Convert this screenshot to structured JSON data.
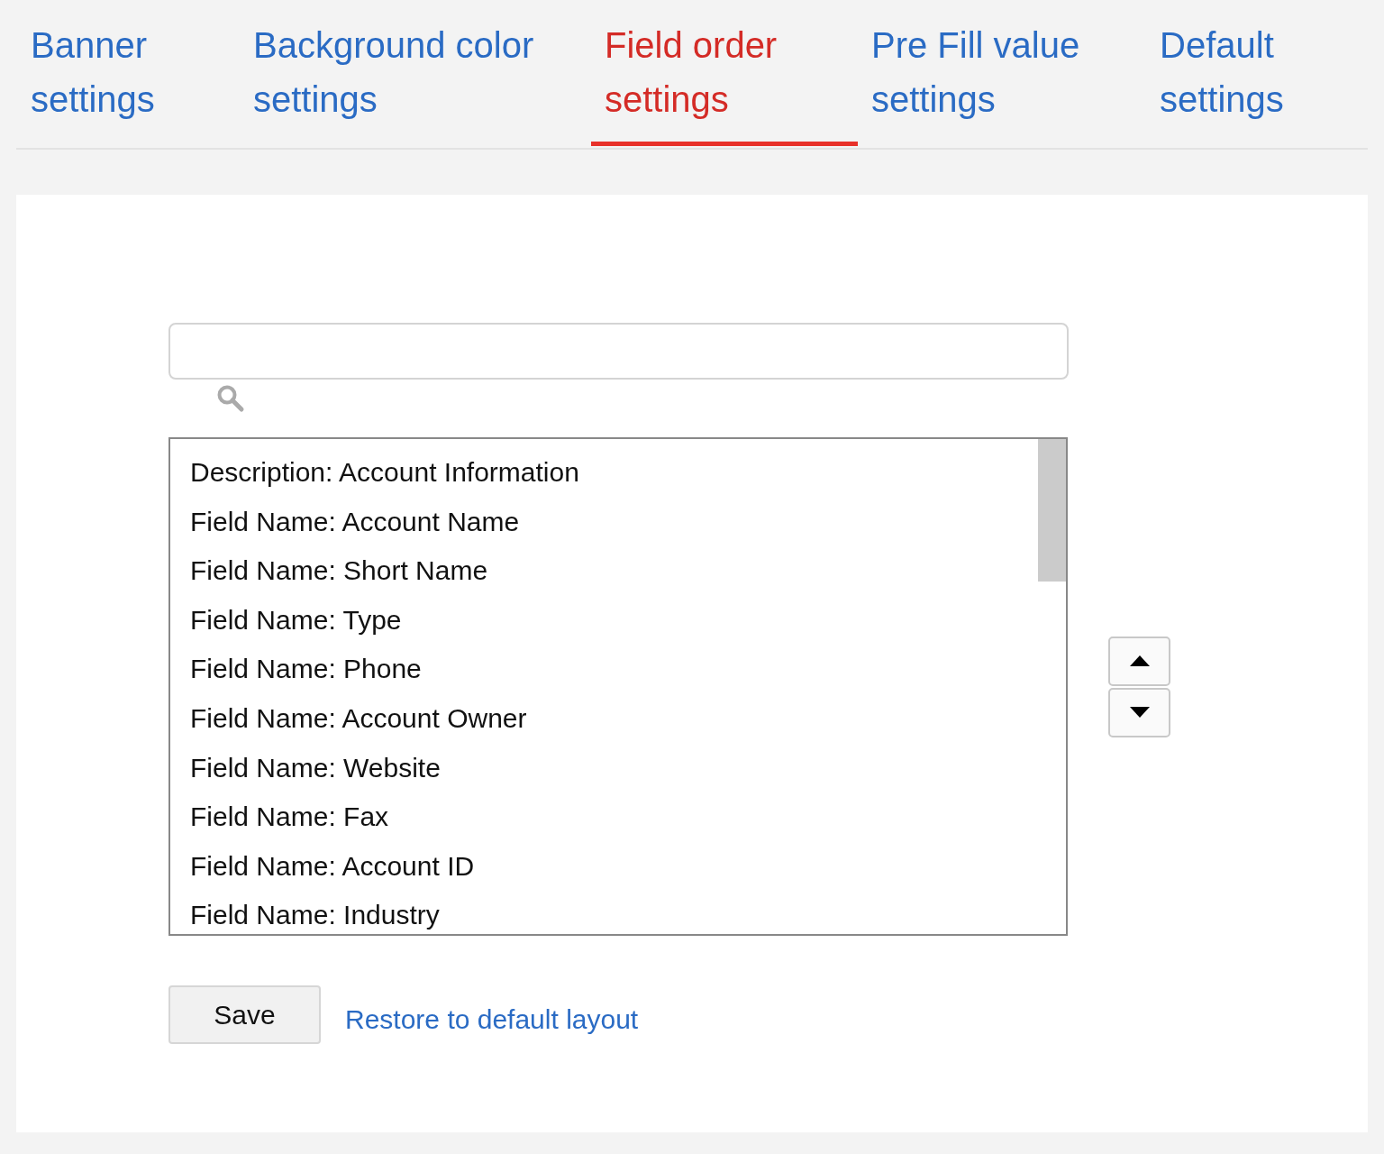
{
  "tabs": [
    {
      "label": "Banner settings",
      "selected": false
    },
    {
      "label": "Background color settings",
      "selected": false
    },
    {
      "label": "Field order settings",
      "selected": true
    },
    {
      "label": "Pre Fill value settings",
      "selected": false
    },
    {
      "label": "Default settings",
      "selected": false
    }
  ],
  "fields": [
    "Description: Account Information",
    "Field Name: Account Name",
    "Field Name: Short Name",
    "Field Name: Type",
    "Field Name: Phone",
    "Field Name: Account Owner",
    "Field Name: Website",
    "Field Name: Fax",
    "Field Name: Account ID",
    "Field Name: Industry"
  ],
  "save_button": "Save",
  "restore_link": "Restore to default layout"
}
